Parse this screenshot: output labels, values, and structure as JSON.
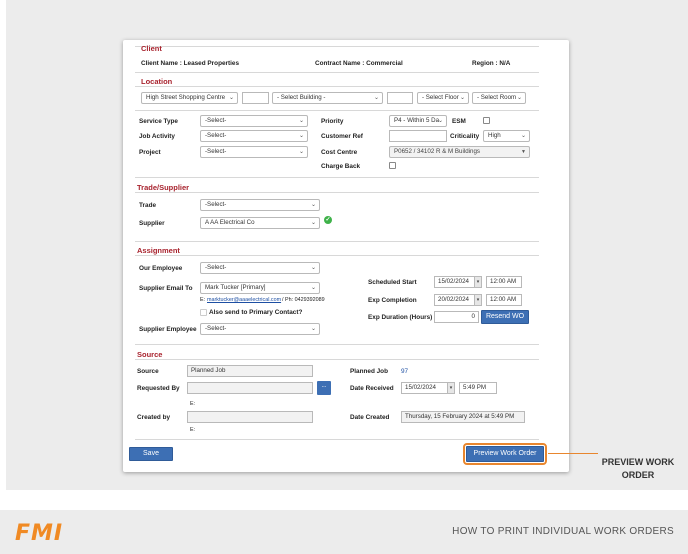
{
  "client": {
    "section_title": "Client",
    "client_name": "Client Name : Leased Properties",
    "contract_name": "Contract Name : Commercial",
    "region": "Region : N/A"
  },
  "location": {
    "section_title": "Location",
    "site": "High Street Shopping Centre",
    "building": "- Select Building -",
    "floor": "- Select Floor",
    "room": "- Select Room"
  },
  "details": {
    "service_type_label": "Service Type",
    "service_type": "-Select-",
    "job_activity_label": "Job Activity",
    "job_activity": "-Select-",
    "project_label": "Project",
    "project": "-Select-",
    "priority_label": "Priority",
    "priority": "P4 - Within 5 Da",
    "esm_label": "ESM",
    "customer_ref_label": "Customer Ref",
    "criticality_label": "Criticality",
    "criticality": "High",
    "cost_centre_label": "Cost Centre",
    "cost_centre": "P0652 / 34102 R & M Buildings",
    "charge_back_label": "Charge Back"
  },
  "trade": {
    "section_title": "Trade/Supplier",
    "trade_label": "Trade",
    "trade": "-Select-",
    "supplier_label": "Supplier",
    "supplier": "A AA Electrical Co"
  },
  "assignment": {
    "section_title": "Assignment",
    "our_employee_label": "Our Employee",
    "our_employee": "-Select-",
    "supplier_email_label": "Supplier Email To",
    "supplier_email": "Mark Tucker [Primary]",
    "email_prefix": "E:",
    "email_link": "marktucker@aaaelectrical.com",
    "phone": "/ Ph: 0429392089",
    "also_send_label": "Also send to Primary Contact?",
    "supplier_employee_label": "Supplier Employee",
    "supplier_employee": "-Select-",
    "scheduled_start_label": "Scheduled Start",
    "scheduled_start_date": "15/02/2024",
    "scheduled_start_time": "12:00 AM",
    "exp_completion_label": "Exp Completion",
    "exp_completion_date": "20/02/2024",
    "exp_completion_time": "12:00 AM",
    "exp_duration_label": "Exp Duration (Hours)",
    "exp_duration": "0",
    "resend_label": "Resend WO"
  },
  "source": {
    "section_title": "Source",
    "source_label": "Source",
    "source_value": "Planned Job",
    "requested_by_label": "Requested By",
    "requested_email_prefix": "E:",
    "dots_label": "...",
    "created_by_label": "Created by",
    "created_email_prefix": "E:",
    "planned_job_label": "Planned Job",
    "planned_job_value": "97",
    "date_received_label": "Date Received",
    "date_received": "15/02/2024",
    "date_received_time": "5:49 PM",
    "date_created_label": "Date Created",
    "date_created": "Thursday, 15 February 2024 at 5:49 PM"
  },
  "actions": {
    "save_label": "Save",
    "preview_label": "Preview Work Order"
  },
  "callout": {
    "line1": "PREVIEW WORK",
    "line2": "ORDER"
  },
  "footer": {
    "logo": "FMI",
    "title": "HOW TO PRINT INDIVIDUAL WORK ORDERS"
  },
  "colors": {
    "accent": "#a8232e",
    "button_blue": "#3d6fb4",
    "callout_orange": "#e8862e",
    "logo_orange": "#f08a24",
    "success_green": "#3fb24a"
  }
}
